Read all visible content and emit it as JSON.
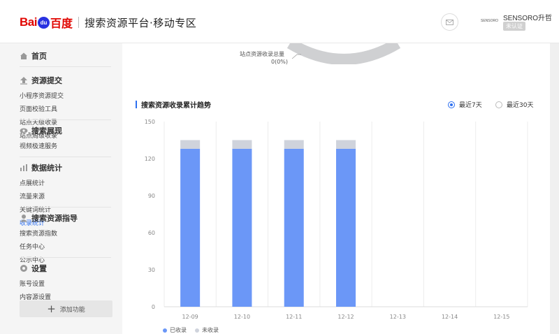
{
  "header": {
    "logo_bai": "Bai",
    "logo_paw": "du",
    "logo_du": "百度",
    "title": "搜索资源平台·移动专区",
    "avatar_text": "SENSORO",
    "user_name": "SENSORO升哲",
    "user_badge": "未认证"
  },
  "sidebar": {
    "groups": [
      {
        "label": "首页",
        "icon": "home-icon",
        "items": []
      },
      {
        "label": "资源提交",
        "icon": "upload-icon",
        "items": [
          "小程序资源提交",
          "页面校验工具",
          "站点天级收录",
          "站点周级收录"
        ]
      },
      {
        "label": "搜索展现",
        "icon": "eye-icon",
        "items": [
          "视频极速服务"
        ]
      },
      {
        "label": "数据统计",
        "icon": "bar-chart-icon",
        "items": [
          "点展统计",
          "流量来源",
          "关键词统计",
          "收录统计"
        ]
      },
      {
        "label": "搜索资源指导",
        "icon": "user-guide-icon",
        "items": [
          "搜索资源指数",
          "任务中心",
          "公示中心"
        ]
      },
      {
        "label": "设置",
        "icon": "gear-icon",
        "items": [
          "账号设置",
          "内容源设置"
        ]
      }
    ],
    "add_label": "添加功能"
  },
  "main": {
    "total_label": "站点资源收录总量",
    "total_value": "0(0%)",
    "section_title": "搜索资源收录累计趋势",
    "radio_7": "最近7天",
    "radio_30": "最近30天"
  },
  "colors": {
    "indexed": "#6b97f7",
    "not_indexed": "#cfd3dc",
    "accent": "#2c6ff0"
  },
  "chart_data": {
    "type": "bar",
    "categories": [
      "12-09",
      "12-10",
      "12-11",
      "12-12",
      "12-13",
      "12-14",
      "12-15"
    ],
    "series": [
      {
        "name": "已收录",
        "values": [
          128,
          128,
          128,
          128,
          0,
          0,
          0
        ]
      },
      {
        "name": "未收录",
        "values": [
          7,
          7,
          7,
          7,
          0,
          0,
          0
        ]
      }
    ],
    "yticks": [
      0,
      30,
      60,
      90,
      120,
      150
    ],
    "ylim": [
      0,
      150
    ],
    "stacked": true,
    "legend_position": "bottom-left",
    "grid": "vertical"
  }
}
